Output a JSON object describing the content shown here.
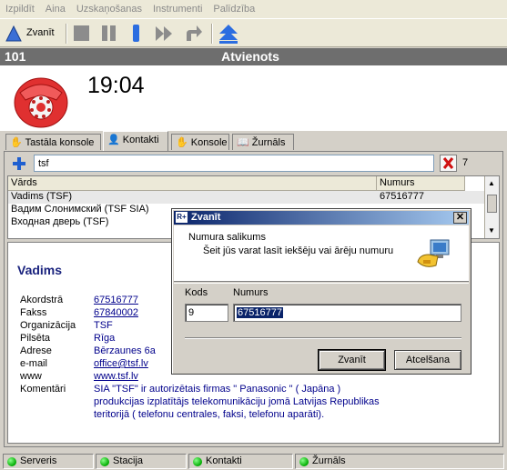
{
  "menu": [
    "Izpildīt",
    "Aina",
    "Uzskaņošanas",
    "Instrumenti",
    "Palīdzība"
  ],
  "toolbar": {
    "call_label": "Zvanīt"
  },
  "status_line": {
    "left": "101",
    "center": "Atvienots"
  },
  "phone": {
    "time": "19:04",
    "icon": "red-telephone-icon"
  },
  "tabs": [
    {
      "label": "Tastāla konsole",
      "icon": "hand-pointer-icon"
    },
    {
      "label": "Kontakti",
      "icon": "person-icon",
      "active": true
    },
    {
      "label": "Konsole",
      "icon": "hand-pointer-icon"
    },
    {
      "label": "Žurnāls",
      "icon": "open-book-icon"
    }
  ],
  "search": {
    "value": "tsf",
    "count": "7"
  },
  "grid": {
    "headers": [
      "Vārds",
      "Numurs"
    ],
    "rows": [
      [
        "Vadims (TSF)",
        "67516777"
      ],
      [
        "Вадим Слонимский (TSF SIA)",
        ""
      ],
      [
        "Входная дверь (TSF)",
        ""
      ]
    ]
  },
  "details": {
    "name": "Vadims",
    "fields": [
      {
        "label": "Akordstrā",
        "value": "67516777",
        "link": true
      },
      {
        "label": "Fakss",
        "value": "67840002",
        "link": true
      },
      {
        "label": "Organizācija",
        "value": "TSF",
        "link": false
      },
      {
        "label": "Pilsēta",
        "value": "Rīga",
        "link": false
      },
      {
        "label": "Adrese",
        "value": "Bērzaunes 6a",
        "link": false
      },
      {
        "label": "e-mail",
        "value": "office@tsf.lv",
        "link": true
      },
      {
        "label": "www",
        "value": "www.tsf.lv",
        "link": true
      },
      {
        "label": "Komentāri",
        "value": "SIA \"TSF\" ir autorizētais firmas \" Panasonic \" ( Japāna )",
        "link": false
      }
    ],
    "comment_lines": [
      "produkcijas izplatītājs telekomunikāciju jomā Latvijas Republikas",
      "teritorijā ( telefonu centrales, faksi, telefonu aparāti)."
    ]
  },
  "statusbar": [
    "Serveris",
    "Stacija",
    "Kontakti",
    "Žurnāls"
  ],
  "dialog": {
    "title": "Zvanīt",
    "heading": "Numura salikums",
    "subheading": "Šeit jūs varat lasīt iekšēju vai ārēju numuru",
    "code_label": "Kods",
    "number_label": "Numurs",
    "code_value": "9",
    "number_value": "67516777",
    "ok_label": "Zvanīt",
    "cancel_label": "Atcelšana"
  },
  "colors": {
    "title_bar": "#6e6e6e",
    "link": "#00008b",
    "dialog_title": "#0a246a"
  }
}
